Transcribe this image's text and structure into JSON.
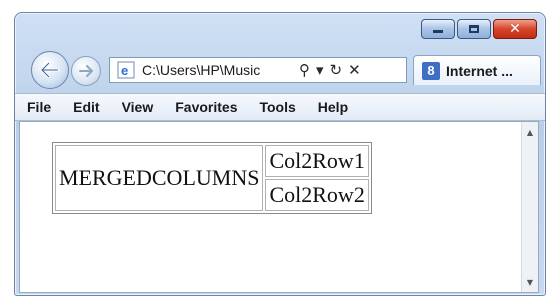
{
  "window": {
    "caption_buttons": [
      "minimize-icon",
      "maximize-icon",
      "close-icon"
    ]
  },
  "nav": {
    "back_icon": "back-arrow-icon",
    "forward_icon": "forward-arrow-icon"
  },
  "address_bar": {
    "value": "C:\\Users\\HP\\Music",
    "tools": [
      "search-icon",
      "dropdown-icon",
      "refresh-icon",
      "stop-icon"
    ]
  },
  "tab": {
    "label": "Internet ..."
  },
  "menu": [
    "File",
    "Edit",
    "View",
    "Favorites",
    "Tools",
    "Help"
  ],
  "page": {
    "table": {
      "merged_cell": "MERGEDCOLUMNS",
      "col2": [
        "Col2Row1",
        "Col2Row2"
      ]
    }
  }
}
